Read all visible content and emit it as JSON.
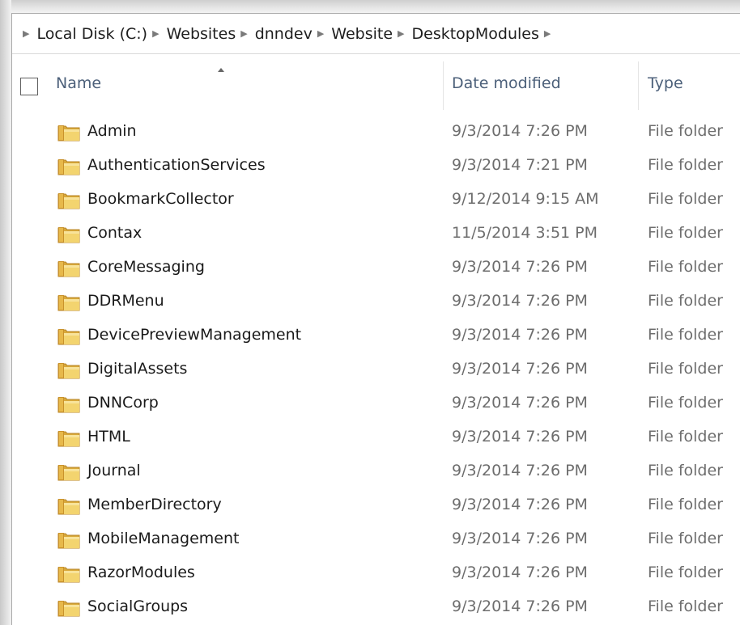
{
  "breadcrumb": {
    "items": [
      "Local Disk (C:)",
      "Websites",
      "dnndev",
      "Website",
      "DesktopModules"
    ]
  },
  "columns": {
    "name": "Name",
    "date_modified": "Date modified",
    "type": "Type"
  },
  "icons": {
    "separator": "chevron-right-icon",
    "folder": "folder-icon",
    "sort": "sort-ascending-icon"
  },
  "colors": {
    "header_text": "#4c607a",
    "folder_yellow": "#e8c252"
  },
  "rows": [
    {
      "name": "Admin",
      "date": "9/3/2014 7:26 PM",
      "type": "File folder"
    },
    {
      "name": "AuthenticationServices",
      "date": "9/3/2014 7:21 PM",
      "type": "File folder"
    },
    {
      "name": "BookmarkCollector",
      "date": "9/12/2014 9:15 AM",
      "type": "File folder"
    },
    {
      "name": "Contax",
      "date": "11/5/2014 3:51 PM",
      "type": "File folder"
    },
    {
      "name": "CoreMessaging",
      "date": "9/3/2014 7:26 PM",
      "type": "File folder"
    },
    {
      "name": "DDRMenu",
      "date": "9/3/2014 7:26 PM",
      "type": "File folder"
    },
    {
      "name": "DevicePreviewManagement",
      "date": "9/3/2014 7:26 PM",
      "type": "File folder"
    },
    {
      "name": "DigitalAssets",
      "date": "9/3/2014 7:26 PM",
      "type": "File folder"
    },
    {
      "name": "DNNCorp",
      "date": "9/3/2014 7:26 PM",
      "type": "File folder"
    },
    {
      "name": "HTML",
      "date": "9/3/2014 7:26 PM",
      "type": "File folder"
    },
    {
      "name": "Journal",
      "date": "9/3/2014 7:26 PM",
      "type": "File folder"
    },
    {
      "name": "MemberDirectory",
      "date": "9/3/2014 7:26 PM",
      "type": "File folder"
    },
    {
      "name": "MobileManagement",
      "date": "9/3/2014 7:26 PM",
      "type": "File folder"
    },
    {
      "name": "RazorModules",
      "date": "9/3/2014 7:26 PM",
      "type": "File folder"
    },
    {
      "name": "SocialGroups",
      "date": "9/3/2014 7:26 PM",
      "type": "File folder"
    }
  ]
}
